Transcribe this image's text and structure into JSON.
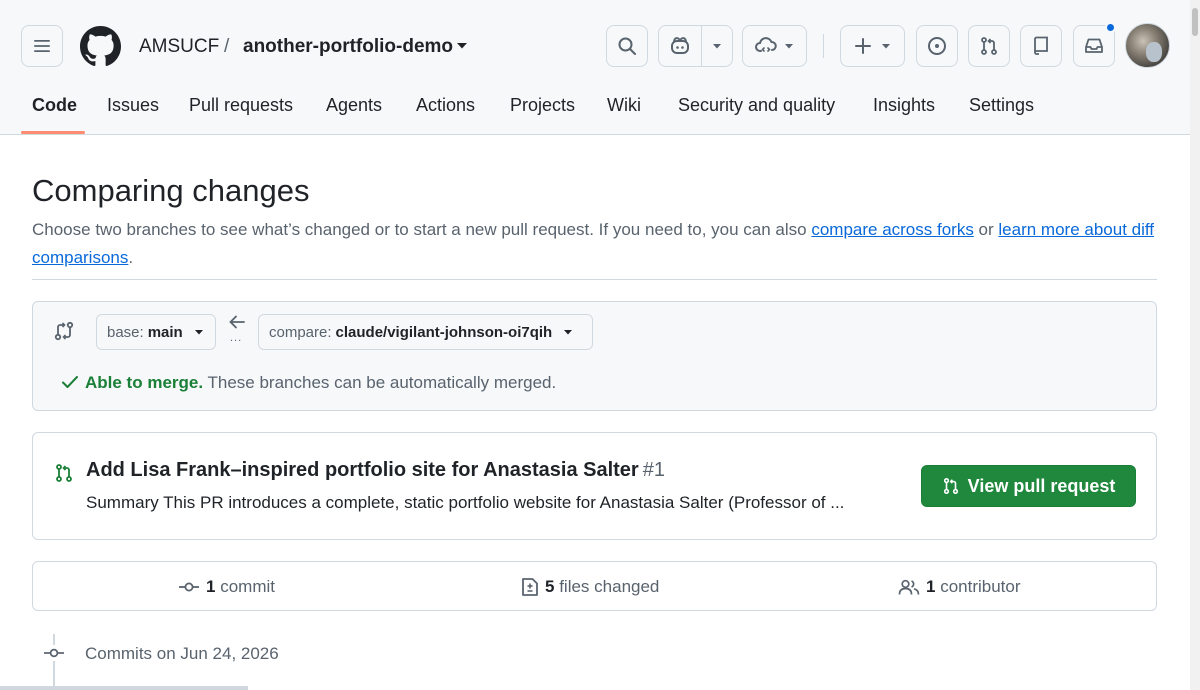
{
  "header": {
    "owner": "AMSUCF",
    "separator": "/",
    "repo": "another-portfolio-demo"
  },
  "nav": {
    "tabs": [
      {
        "label": "Code",
        "active": true
      },
      {
        "label": "Issues"
      },
      {
        "label": "Pull requests"
      },
      {
        "label": "Agents"
      },
      {
        "label": "Actions"
      },
      {
        "label": "Projects"
      },
      {
        "label": "Wiki"
      },
      {
        "label": "Security and quality"
      },
      {
        "label": "Insights"
      },
      {
        "label": "Settings"
      }
    ]
  },
  "main": {
    "title": "Comparing changes",
    "desc_text": "Choose two branches to see what’s changed or to start a new pull request. If you need to, you can also ",
    "link_forks": "compare across forks",
    "desc_or": " or ",
    "link_learn": "learn more about diff comparisons",
    "desc_end": "."
  },
  "compare": {
    "base_prefix": "base:",
    "base_branch": "main",
    "compare_prefix": "compare:",
    "compare_branch": "claude/vigilant-johnson-oi7qih",
    "dots": "...",
    "merge_ok": "Able to merge.",
    "merge_msg": " These branches can be automatically merged."
  },
  "pr": {
    "title": "Add Lisa Frank–inspired portfolio site for Anastasia Salter",
    "number": "#1",
    "summary": "Summary This PR introduces a complete, static portfolio website for Anastasia Salter (Professor of ...",
    "button": "View pull request"
  },
  "stats": {
    "commits_count": "1",
    "commits_label": "commit",
    "files_count": "5",
    "files_label": "files changed",
    "contrib_count": "1",
    "contrib_label": "contributor"
  },
  "timeline": {
    "date_label": "Commits on Jun 24, 2026"
  },
  "colors": {
    "accent": "#0969da",
    "success": "#1f883d",
    "nav_underline": "#fd8c73",
    "notification": "#0969da"
  },
  "icons": [
    "hamburger-icon",
    "github-logo-icon",
    "search-icon",
    "copilot-icon",
    "codespace-icon",
    "plus-icon",
    "issue-icon",
    "pull-request-icon",
    "repo-icon",
    "inbox-icon",
    "check-icon",
    "git-commit-icon",
    "file-diff-icon",
    "people-icon"
  ]
}
